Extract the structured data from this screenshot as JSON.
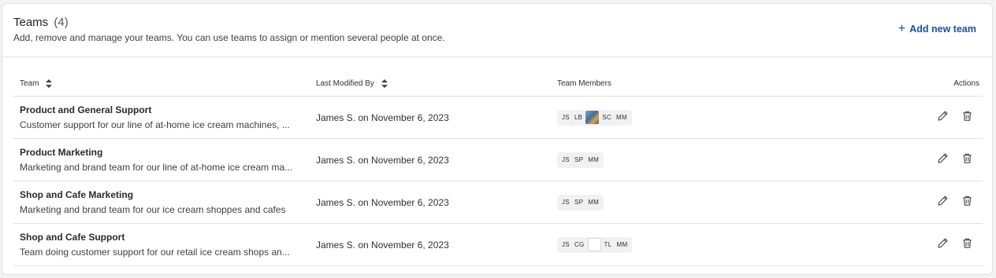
{
  "header": {
    "title": "Teams",
    "count": "(4)",
    "subtitle": "Add, remove and manage your teams. You can use teams to assign or mention several people at once.",
    "add_label": "Add new team"
  },
  "columns": {
    "team": "Team",
    "modified": "Last Modified By",
    "members": "Team Members",
    "actions": "Actions"
  },
  "rows": [
    {
      "name": "Product and General Support",
      "desc": "Customer support for our line of at-home ice cream machines, ...",
      "modified": "James S. on November 6, 2023",
      "members": [
        "JS",
        "LB",
        "img-a",
        "SC",
        "MM"
      ]
    },
    {
      "name": "Product Marketing",
      "desc": "Marketing and brand team for our line of at-home ice cream ma...",
      "modified": "James S. on November 6, 2023",
      "members": [
        "JS",
        "SP",
        "MM"
      ]
    },
    {
      "name": "Shop and Cafe Marketing",
      "desc": "Marketing and brand team for our ice cream shoppes and cafes",
      "modified": "James S. on November 6, 2023",
      "members": [
        "JS",
        "SP",
        "MM"
      ]
    },
    {
      "name": "Shop and Cafe Support",
      "desc": "Team doing customer support for our retail ice cream shops an...",
      "modified": "James S. on November 6, 2023",
      "members": [
        "JS",
        "CG",
        "img-b",
        "TL",
        "MM"
      ]
    }
  ],
  "colors": {
    "accent": "#1f4fa3",
    "border": "#e1e1e1",
    "chip_bg": "#f1f1f1"
  },
  "icons": {
    "add": "plus-icon",
    "sort": "sort-icon",
    "edit": "pencil-icon",
    "delete": "trash-icon"
  }
}
